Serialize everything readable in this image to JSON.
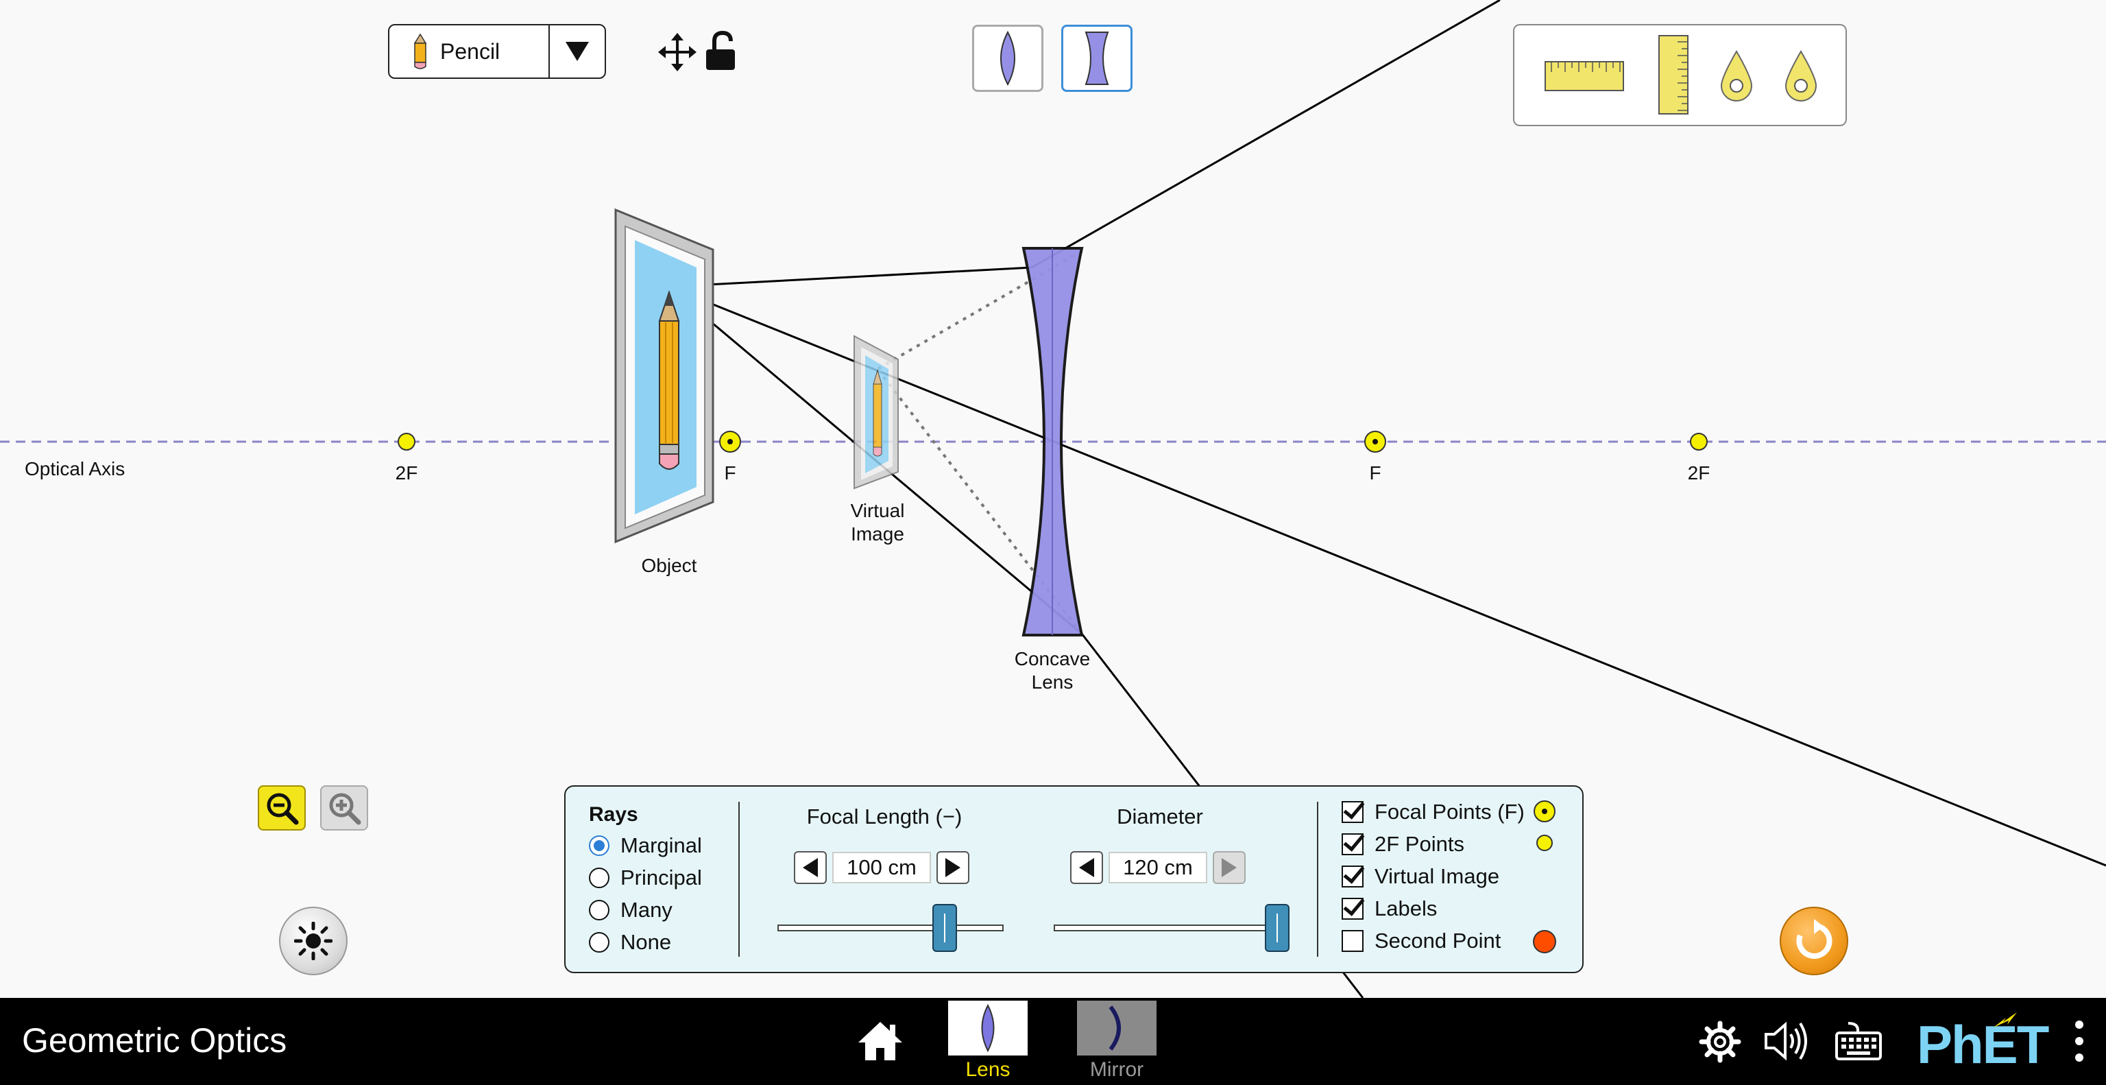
{
  "object_selector": {
    "label": "Pencil",
    "icon": "pencil-icon"
  },
  "toolbar_icons": {
    "drag": "move-arrows-icon",
    "lock": "unlocked-padlock-icon"
  },
  "lens_types": [
    {
      "name": "convex-lens-icon",
      "selected": false
    },
    {
      "name": "concave-lens-icon",
      "selected": true
    }
  ],
  "toolbox": [
    "horizontal-ruler-icon",
    "vertical-ruler-icon",
    "light-spot-probe-icon",
    "position-marker-icon"
  ],
  "scene": {
    "optical_axis_label": "Optical Axis",
    "left_2f": "2F",
    "left_f": "F",
    "right_f": "F",
    "right_2f": "2F",
    "object_label": "Object",
    "virtual_image_label_1": "Virtual",
    "virtual_image_label_2": "Image",
    "lens_label_1": "Concave",
    "lens_label_2": "Lens",
    "colors": {
      "axis": "#8a84c8",
      "lens_fill": "#9590e6",
      "focal_point": "#f5f000",
      "second_point": "#ff4d00"
    }
  },
  "panel": {
    "rays": {
      "title": "Rays",
      "options": [
        {
          "label": "Marginal",
          "selected": true
        },
        {
          "label": "Principal",
          "selected": false
        },
        {
          "label": "Many",
          "selected": false
        },
        {
          "label": "None",
          "selected": false
        }
      ]
    },
    "focal_length": {
      "title": "Focal Length (−)",
      "value": "100 cm",
      "slider_fraction": 0.76
    },
    "diameter": {
      "title": "Diameter",
      "value": "120 cm",
      "slider_fraction": 1.0
    },
    "checks": [
      {
        "label": "Focal Points (F)",
        "checked": true
      },
      {
        "label": "2F Points",
        "checked": true
      },
      {
        "label": "Virtual Image",
        "checked": true
      },
      {
        "label": "Labels",
        "checked": true
      },
      {
        "label": "Second Point",
        "checked": false
      }
    ]
  },
  "controls": {
    "zoom_out": "zoom-out-icon",
    "zoom_in": "zoom-in-icon",
    "light": "light-brightness-icon",
    "reset": "reset-icon"
  },
  "navbar": {
    "title": "Geometric Optics",
    "screens": [
      {
        "label": "Lens",
        "selected": true
      },
      {
        "label": "Mirror",
        "selected": false
      }
    ],
    "brand": "PhET"
  }
}
